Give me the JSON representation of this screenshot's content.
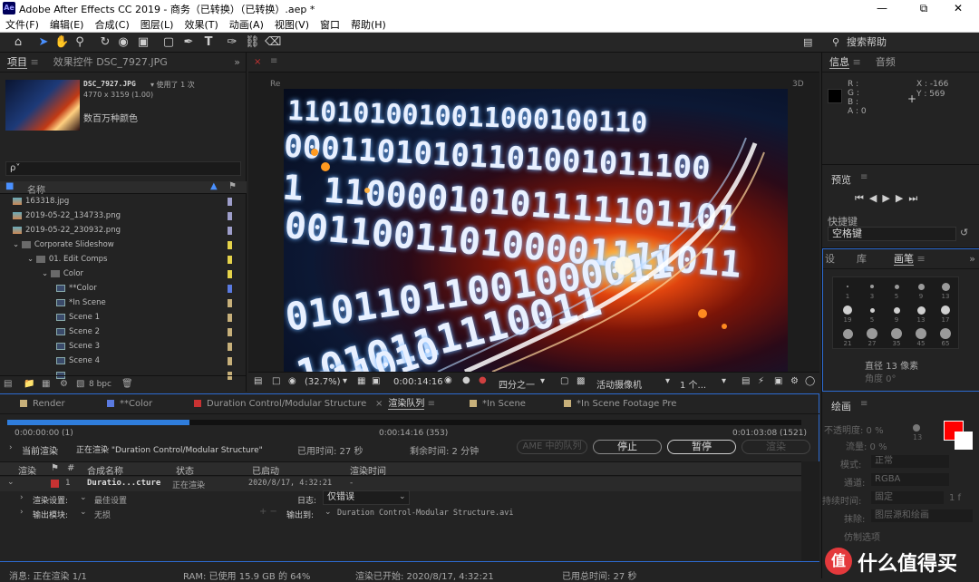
{
  "app": {
    "logo": "Ae",
    "title": "Adobe After Effects CC 2019 - 商务（已转换）（已转换）.aep *",
    "window_controls": [
      "minimize-icon",
      "restore-icon",
      "close-icon"
    ]
  },
  "menu": [
    "文件(F)",
    "编辑(E)",
    "合成(C)",
    "图层(L)",
    "效果(T)",
    "动画(A)",
    "视图(V)",
    "窗口",
    "帮助(H)"
  ],
  "toolbar": {
    "tools": [
      "home-icon",
      "selection-arrow-icon",
      "hand-icon",
      "zoom-icon",
      "rotate-icon",
      "camera-icon",
      "pan-behind-icon",
      "rectangle-icon",
      "pen-icon",
      "type-icon",
      "brush-icon",
      "clone-stamp-icon",
      "eraser-icon"
    ],
    "search_help": "搜索帮助"
  },
  "project": {
    "tabs": [
      "项目",
      "效果控件 DSC_7927.JPG"
    ],
    "selected_file": "DSC_7927.JPG",
    "used": "▾ 使用了 1 次",
    "dimensions": "4770 x 3159 (1.00)",
    "color_depth": "数百万种颜色",
    "search_placeholder": "ρ˅",
    "name_header": "名称",
    "bpc": "8 bpc",
    "items": [
      {
        "name": "163318.jpg",
        "type": "image",
        "indent": 0,
        "color": "#9e9eca"
      },
      {
        "name": "2019-05-22_134733.png",
        "type": "image",
        "indent": 0,
        "color": "#9e9eca"
      },
      {
        "name": "2019-05-22_230932.png",
        "type": "image",
        "indent": 0,
        "color": "#9e9eca"
      },
      {
        "name": "Corporate Slideshow",
        "type": "folder",
        "indent": 0,
        "color": "#e5d34a"
      },
      {
        "name": "01. Edit Comps",
        "type": "folder",
        "indent": 1,
        "color": "#e5d34a"
      },
      {
        "name": "Color",
        "type": "folder",
        "indent": 2,
        "color": "#e5d34a"
      },
      {
        "name": "**Color",
        "type": "comp",
        "indent": 3,
        "color": "#5a7ae0"
      },
      {
        "name": "*In Scene",
        "type": "comp",
        "indent": 3,
        "color": "#c7b07a"
      },
      {
        "name": "Scene 1",
        "type": "comp",
        "indent": 3,
        "color": "#c7b07a"
      },
      {
        "name": "Scene 2",
        "type": "comp",
        "indent": 3,
        "color": "#c7b07a"
      },
      {
        "name": "Scene 3",
        "type": "comp",
        "indent": 3,
        "color": "#c7b07a"
      },
      {
        "name": "Scene 4",
        "type": "comp",
        "indent": 3,
        "color": "#c7b07a"
      },
      {
        "name": "",
        "type": "comp",
        "indent": 3,
        "color": "#c7b07a"
      }
    ]
  },
  "viewer": {
    "tab_left": "Re",
    "tab_right": "3D",
    "binary_lines": [
      "1101010010011000100110",
      "00011010101101001011100",
      "1 11000010101111101101",
      "001100110100001111011",
      "01011011001000011",
      "1010111110011",
      "0011010"
    ],
    "zoom": "(32.7%)",
    "timecode": "0:00:14:16",
    "resolution": "四分之一",
    "camera": "活动摄像机",
    "views": "1 个..."
  },
  "info": {
    "tabs": [
      "信息",
      "音频"
    ],
    "rgba": [
      "R :",
      "G :",
      "B :",
      "A : 0"
    ],
    "x": "X : -166",
    "y": "Y : 569"
  },
  "preview": {
    "title": "预览",
    "shortcut_label": "快捷键",
    "shortcut_value": "空格键"
  },
  "brushes": {
    "tabs": [
      "设",
      "库",
      "画笔"
    ],
    "sizes": [
      "1",
      "3",
      "5",
      "9",
      "13",
      "19",
      "5",
      "9",
      "13",
      "17",
      "21",
      "27",
      "35",
      "45",
      "65"
    ],
    "diameter": "直径 13 像素",
    "angle": "角度 0°"
  },
  "paint": {
    "title": "绘画",
    "opacity": "不透明度: 0 %",
    "flow": "流量: 0 %",
    "mode_label": "模式:",
    "mode_value": "正常",
    "channel_label": "通道:",
    "channel_value": "RGBA",
    "duration_label": "持续时间:",
    "duration_value": "固定",
    "erase_label": "抹除:",
    "erase_value": "图层源和绘画",
    "clone_options": "仿制选项",
    "brush_size": "13",
    "frame": "1 f",
    "fg_color": "#ff0000",
    "bg_color": "#ffffff"
  },
  "render_queue": {
    "tabs": [
      {
        "label": "Render",
        "color": "#c7b07a"
      },
      {
        "label": "**Color",
        "color": "#5a7ae0"
      },
      {
        "label": "Duration Control/Modular Structure",
        "color": "#c83232"
      },
      {
        "label": "渲染队列",
        "color": ""
      },
      {
        "label": "*In Scene",
        "color": "#c7b07a"
      },
      {
        "label": "*In Scene Footage Pre",
        "color": "#c7b07a"
      }
    ],
    "progress": 0.23,
    "time_start": "0:00:00:00 (1)",
    "time_current": "0:00:14:16 (353)",
    "time_end": "0:01:03:08 (1521)",
    "current_render_label": "当前渲染",
    "rendering_text": "正在渲染 \"Duration Control/Modular Structure\"",
    "elapsed": "已用时间:  27 秒",
    "remaining": "剩余时间:  2 分钟",
    "ame_queue": "AME 中的队列",
    "stop": "停止",
    "pause": "暂停",
    "render": "渲染",
    "columns": [
      "渲染",
      "#",
      "合成名称",
      "状态",
      "已启动",
      "渲染时间"
    ],
    "row": {
      "num": "1",
      "name": "Duratio...cture",
      "status": "正在渲染",
      "started": "2020/8/17, 4:32:21",
      "render_time": "-"
    },
    "render_settings_label": "渲染设置:",
    "render_settings_value": "最佳设置",
    "log_label": "日志:",
    "log_value": "仅错误",
    "output_module_label": "输出模块:",
    "output_module_value": "无损",
    "output_to_label": "输出到:",
    "output_to_value": "Duration Control-Modular Structure.avi"
  },
  "status": {
    "message": "消息:  正在渲染 1/1",
    "ram": "RAM:  已使用 15.9 GB 的 64%",
    "render_started": "渲染已开始:  2020/8/17, 4:32:21",
    "total_time": "已用总时间:  27 秒"
  },
  "watermark": "值 什么值得买"
}
